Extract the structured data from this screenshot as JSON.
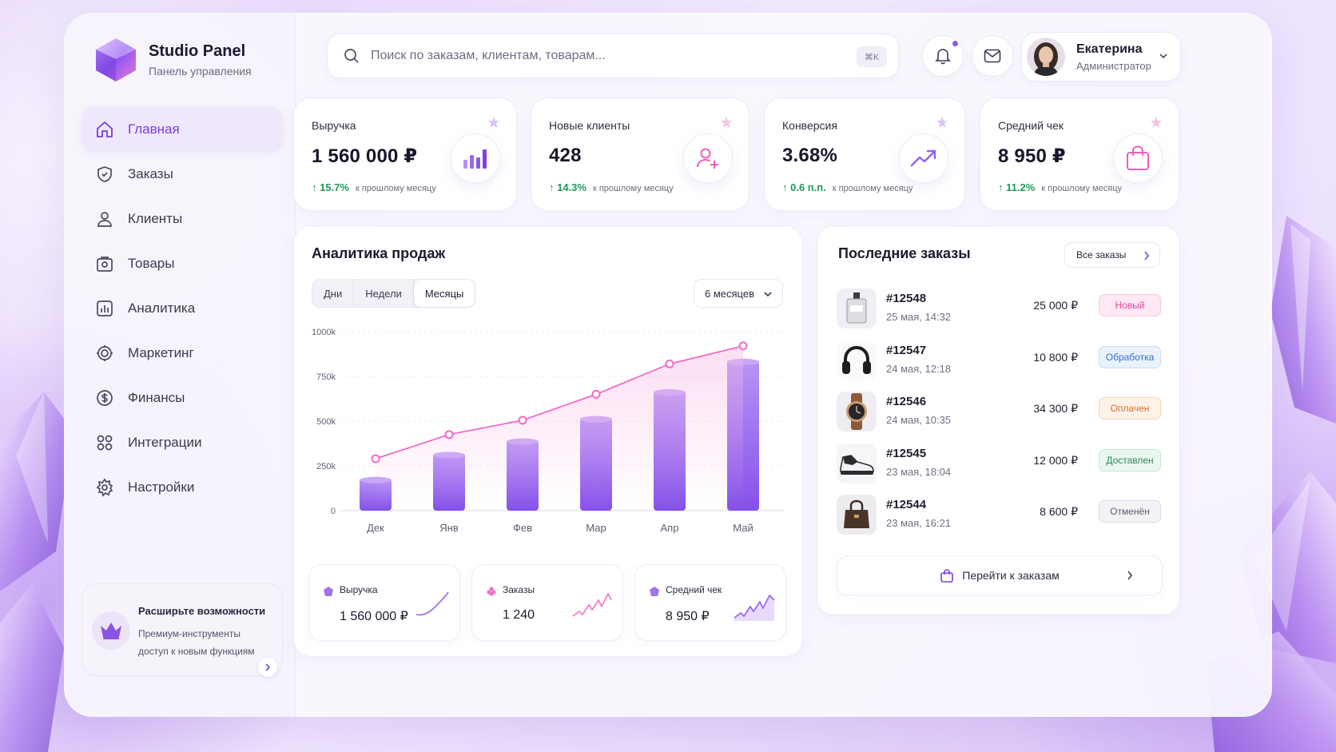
{
  "brand": {
    "title": "Studio Panel",
    "subtitle": "Панель управления"
  },
  "nav": [
    {
      "label": "Главная",
      "icon": "home-icon",
      "active": true
    },
    {
      "label": "Заказы",
      "icon": "shield-icon"
    },
    {
      "label": "Клиенты",
      "icon": "user-icon"
    },
    {
      "label": "Товары",
      "icon": "box-icon"
    },
    {
      "label": "Аналитика",
      "icon": "analytics-icon"
    },
    {
      "label": "Маркетинг",
      "icon": "marketing-icon"
    },
    {
      "label": "Финансы",
      "icon": "dollar-icon"
    },
    {
      "label": "Интеграции",
      "icon": "grid-icon"
    },
    {
      "label": "Настройки",
      "icon": "gear-icon"
    }
  ],
  "upgrade": {
    "title": "Расширьте возможности",
    "line1": "Премиум-инструменты",
    "line2": "доступ к новым функциям"
  },
  "search": {
    "placeholder": "Поиск по заказам, клиентам, товарам...",
    "shortcut": "⌘K"
  },
  "user": {
    "name": "Екатерина",
    "role": "Администратор"
  },
  "kpis": [
    {
      "title": "Выручка",
      "value": "1 560 000 ₽",
      "delta": "↑ 15.7%",
      "note": "к прошлому месяцу",
      "icon": "bar-chart-icon"
    },
    {
      "title": "Новые клиенты",
      "value": "428",
      "delta": "↑ 14.3%",
      "note": "к прошлому месяцу",
      "icon": "user-plus-icon"
    },
    {
      "title": "Конверсия",
      "value": "3.68%",
      "delta": "↑ 0.6 п.п.",
      "note": "к прошлому месяцу",
      "icon": "trend-up-icon"
    },
    {
      "title": "Средний чек",
      "value": "8 950 ₽",
      "delta": "↑ 11.2%",
      "note": "к прошлому месяцу",
      "icon": "shopping-bag-icon"
    }
  ],
  "analytics": {
    "title": "Аналитика продаж",
    "tabs": [
      "Дни",
      "Недели",
      "Месяцы"
    ],
    "active_tab": "Месяцы",
    "period": "6 месяцев"
  },
  "chart_data": {
    "type": "bar",
    "categories": [
      "Дек",
      "Янв",
      "Фев",
      "Мар",
      "Апр",
      "Май"
    ],
    "series": [
      {
        "type": "bar",
        "values": [
          180,
          320,
          395,
          520,
          670,
          840
        ]
      },
      {
        "type": "line",
        "values": [
          290,
          425,
          505,
          650,
          820,
          920
        ]
      }
    ],
    "yticks": [
      "0",
      "250k",
      "500k",
      "750k",
      "1000k"
    ],
    "ylim": [
      0,
      1000
    ],
    "grid": true,
    "colors": {
      "bar": "#9a66f0",
      "line": "#f06cc8"
    }
  },
  "mini_stats": [
    {
      "label": "Выручка",
      "value": "1 560 000 ₽",
      "color": "#a174e8"
    },
    {
      "label": "Заказы",
      "value": "1 240",
      "color": "#ee74c8"
    },
    {
      "label": "Средний чек",
      "value": "8 950 ₽",
      "color": "#a174e8"
    }
  ],
  "orders": {
    "title": "Последние заказы",
    "all_label": "Все заказы",
    "goto_label": "Перейти к заказам",
    "items": [
      {
        "id": "#12548",
        "date": "25 мая, 14:32",
        "amount": "25 000 ₽",
        "status": "Новый",
        "thumb": "perfume-icon",
        "color": "#e3479f",
        "bg": "#fde8f4",
        "border": "#f8c9e3"
      },
      {
        "id": "#12547",
        "date": "24 мая, 12:18",
        "amount": "10 800 ₽",
        "status": "Обработка",
        "thumb": "headphones-icon",
        "color": "#2f6fd8",
        "bg": "#eaf2fe",
        "border": "#c8dbf8"
      },
      {
        "id": "#12546",
        "date": "24 мая, 10:35",
        "amount": "34 300 ₽",
        "status": "Оплачен",
        "thumb": "watch-icon",
        "color": "#d1702d",
        "bg": "#fef2e7",
        "border": "#f5d6bb"
      },
      {
        "id": "#12545",
        "date": "23 мая, 18:04",
        "amount": "12 000 ₽",
        "status": "Доставлен",
        "thumb": "sneaker-icon",
        "color": "#2a8a4e",
        "bg": "#e9f7ee",
        "border": "#c5e8d1"
      },
      {
        "id": "#12544",
        "date": "23 мая, 16:21",
        "amount": "8 600 ₽",
        "status": "Отменён",
        "thumb": "handbag-icon",
        "color": "#5e5b70",
        "bg": "#f3f2f6",
        "border": "#dddbe5"
      }
    ]
  }
}
